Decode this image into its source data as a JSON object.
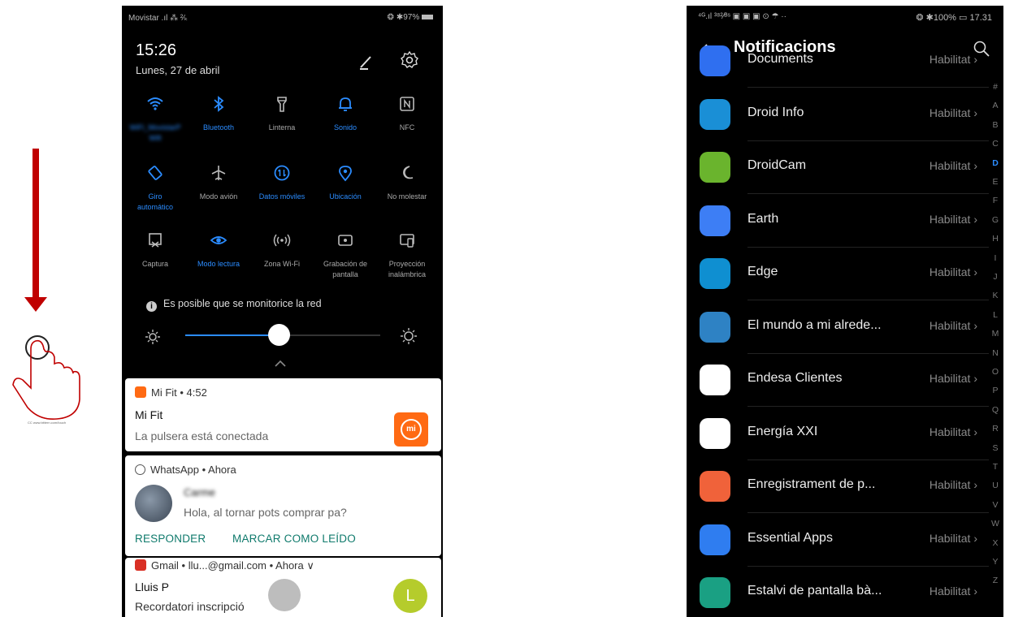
{
  "gesture": {
    "arrow_color": "#c00000",
    "hand_icon": "swipe-down-hand-icon",
    "credit": "CC www.bittern.com/touch"
  },
  "left_phone": {
    "status_left": "Movistar .ıl ⁂ ²⁄ₖ",
    "status_right": "❂ ✱97%",
    "time": "15:26",
    "date": "Lunes, 27 de abril",
    "tiles": [
      {
        "label": "WiFi_MovistarP",
        "sub": "Wifi",
        "icon": "wifi-icon",
        "on": true
      },
      {
        "label": "Bluetooth",
        "icon": "bluetooth-icon",
        "on": true
      },
      {
        "label": "Linterna",
        "icon": "flashlight-icon",
        "on": false
      },
      {
        "label": "Sonido",
        "icon": "bell-icon",
        "on": true
      },
      {
        "label": "NFC",
        "icon": "nfc-icon",
        "on": false
      },
      {
        "label": "Giro",
        "sub": "automático",
        "icon": "rotate-icon",
        "on": true
      },
      {
        "label": "Modo avión",
        "icon": "airplane-icon",
        "on": false
      },
      {
        "label": "Datos móviles",
        "icon": "mobile-data-icon",
        "on": true
      },
      {
        "label": "Ubicación",
        "icon": "location-icon",
        "on": true
      },
      {
        "label": "No molestar",
        "icon": "moon-icon",
        "on": false
      },
      {
        "label": "Captura",
        "icon": "screenshot-icon",
        "on": false
      },
      {
        "label": "Modo lectura",
        "icon": "eye-icon",
        "on": true
      },
      {
        "label": "Zona Wi-Fi",
        "icon": "hotspot-icon",
        "on": false
      },
      {
        "label": "Grabación de",
        "sub": "pantalla",
        "icon": "screen-record-icon",
        "on": false
      },
      {
        "label": "Proyección",
        "sub": "inalámbrica",
        "icon": "cast-icon",
        "on": false
      }
    ],
    "network_notice": "Es posible que se monitorice la red",
    "brightness_level": 0.48,
    "notifications": {
      "mifit": {
        "header": "Mi Fit • 4:52",
        "title": "Mi Fit",
        "text": "La pulsera está conectada",
        "logo": "mi"
      },
      "whatsapp": {
        "header": "WhatsApp • Ahora",
        "sender": "Carme",
        "text": "Hola, al tornar pots comprar pa?",
        "action_reply": "RESPONDER",
        "action_read": "MARCAR COMO LEÍDO"
      },
      "gmail": {
        "header": "Gmail • llu...@gmail.com • Ahora",
        "title": "Lluis P",
        "text": "Recordatori inscripció",
        "avatar_letter": "L"
      }
    }
  },
  "right_phone": {
    "status_left": "⁴ᴳ.ıl ³⁸²⁄ᴮˢ ▣ ▣ ▣ ⊙ ☂ ··",
    "status_right": "❂ ✱100% ▭ 17.31",
    "title": "Notificacions",
    "status_label": "Habilitat",
    "apps": [
      {
        "name": "Documents",
        "color": "#2f6ff0",
        "icon": "documents-app-icon"
      },
      {
        "name": "Droid Info",
        "color": "#1a8fd6",
        "icon": "droid-info-app-icon"
      },
      {
        "name": "DroidCam",
        "color": "#6ab42d",
        "icon": "droidcam-app-icon"
      },
      {
        "name": "Earth",
        "color": "#3d7ef5",
        "icon": "earth-app-icon"
      },
      {
        "name": "Edge",
        "color": "#0f8fd1",
        "icon": "edge-app-icon"
      },
      {
        "name": "El mundo a mi alrede...",
        "color": "#2e82c4",
        "icon": "wam-app-icon"
      },
      {
        "name": "Endesa Clientes",
        "color": "#ffffff",
        "icon": "endesa-app-icon"
      },
      {
        "name": "Energía XXI",
        "color": "#ffffff",
        "icon": "energia-xxi-app-icon"
      },
      {
        "name": "Enregistrament de p...",
        "color": "#f0623a",
        "icon": "screen-recorder-app-icon"
      },
      {
        "name": "Essential Apps",
        "color": "#2f7df0",
        "icon": "essential-apps-icon"
      },
      {
        "name": "Estalvi de pantalla bà...",
        "color": "#1aa083",
        "icon": "android-app-icon"
      }
    ],
    "index_letters": [
      "#",
      "A",
      "B",
      "C",
      "D",
      "E",
      "F",
      "G",
      "H",
      "I",
      "J",
      "K",
      "L",
      "M",
      "N",
      "O",
      "P",
      "Q",
      "R",
      "S",
      "T",
      "U",
      "V",
      "W",
      "X",
      "Y",
      "Z"
    ],
    "index_active": "D",
    "accent": "#2b8cff"
  }
}
